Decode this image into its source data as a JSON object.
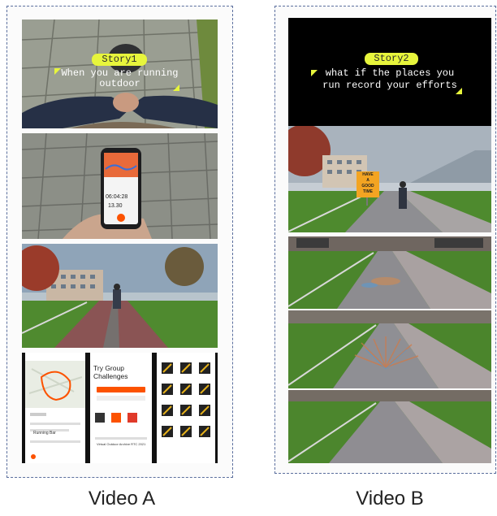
{
  "video_a": {
    "caption": "Video A",
    "story": {
      "label": "Story1",
      "line1": "When you are running",
      "line2": "outdoor"
    },
    "phone": {
      "pace": "06:04:28",
      "dist": "13.30"
    },
    "app": {
      "title": "Try Group Challenges",
      "legend_word": "Running Bar",
      "bottom_title": "Virtual Outdoor Archive RTC 2021"
    }
  },
  "video_b": {
    "caption": "Video B",
    "story": {
      "label": "Story2",
      "line1": "what if the places you",
      "line2": "run record your efforts"
    },
    "sign": {
      "line1": "HAVE",
      "line2": "A",
      "line3": "GOOD",
      "line4": "TIME"
    }
  },
  "colors": {
    "accent_yellow": "#e7f53c",
    "panel_border": "#5b6f9e",
    "strava_orange": "#fc5200"
  }
}
